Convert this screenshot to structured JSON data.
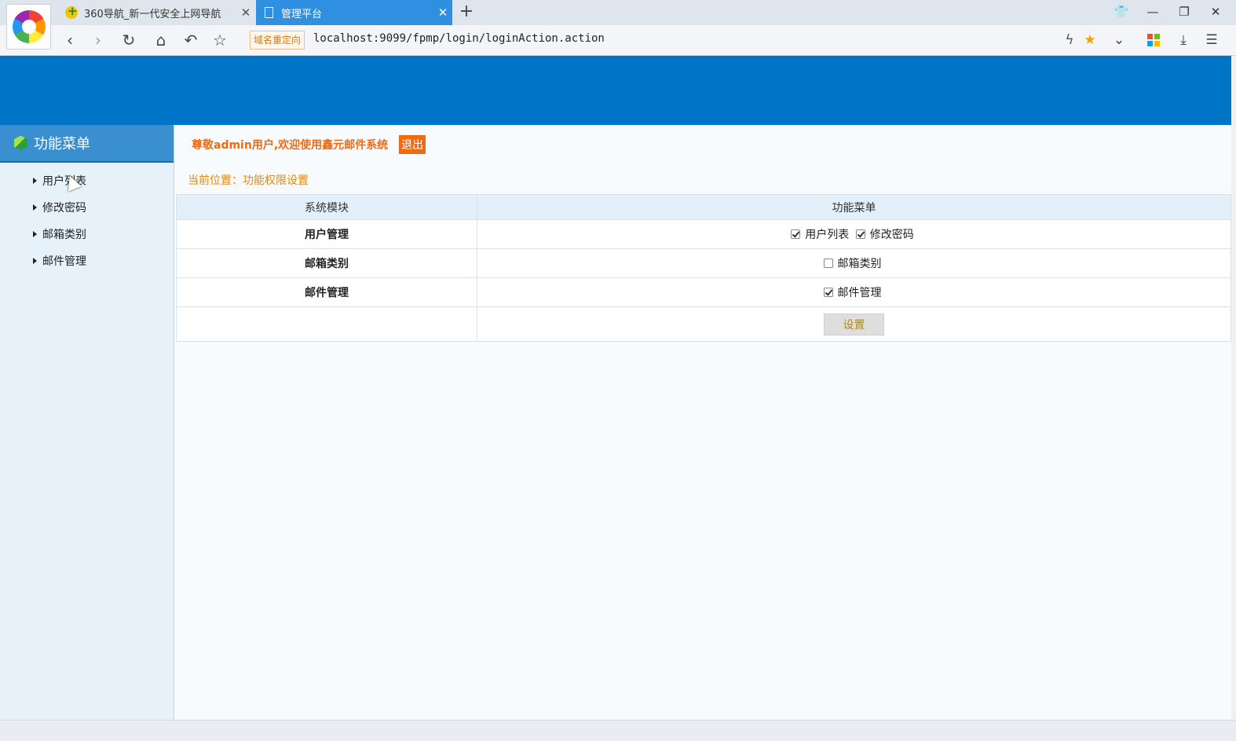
{
  "browser": {
    "tabs": [
      {
        "label": "360导航_新一代安全上网导航",
        "active": false
      },
      {
        "label": "管理平台",
        "active": true
      }
    ],
    "redirect_badge": "域名重定向",
    "url": "localhost:9099/fpmp/login/loginAction.action",
    "controls": {
      "shirt": "👕",
      "minimize": "—",
      "restore": "❐",
      "close": "✕",
      "close_tab": "✕",
      "new_tab": "+"
    },
    "nav_glyphs": {
      "back": "‹",
      "forward": "›",
      "reload": "↻",
      "home": "⌂",
      "undo": "↶",
      "star": "☆",
      "bolt": "ϟ",
      "star_on": "★",
      "dropdown": "⌄",
      "download": "⤓",
      "menu": "☰"
    },
    "colors": {
      "active_tab": "#2f8fe0",
      "accent_star": "#f5a300"
    }
  },
  "sidebar": {
    "title": "功能菜单",
    "items": [
      {
        "label": "用户列表"
      },
      {
        "label": "修改密码"
      },
      {
        "label": "邮箱类别"
      },
      {
        "label": "邮件管理"
      }
    ]
  },
  "header": {
    "welcome": "尊敬admin用户,欢迎使用鑫元邮件系统",
    "logout": "退出",
    "location": "当前位置：功能权限设置"
  },
  "permissions": {
    "columns": [
      "系统模块",
      "功能菜单"
    ],
    "rows": [
      {
        "module": "用户管理",
        "options": [
          {
            "label": "用户列表",
            "checked": true
          },
          {
            "label": "修改密码",
            "checked": true
          }
        ]
      },
      {
        "module": "邮箱类别",
        "options": [
          {
            "label": "邮箱类别",
            "checked": false
          }
        ]
      },
      {
        "module": "邮件管理",
        "options": [
          {
            "label": "邮件管理",
            "checked": true
          }
        ]
      }
    ],
    "submit_label": "设置"
  },
  "colors": {
    "banner": "#0075c8",
    "sidebar_head": "#3a8fd0",
    "accent_orange": "#f06a14",
    "location_text": "#e8880f"
  }
}
